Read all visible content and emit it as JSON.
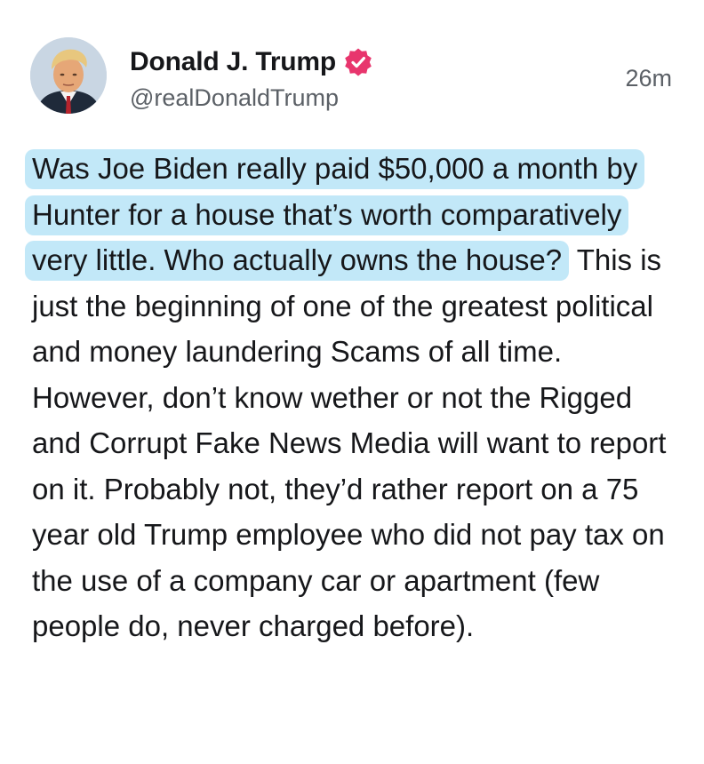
{
  "post": {
    "author": {
      "display_name": "Donald J. Trump",
      "handle": "@realDonaldTrump",
      "verified": true,
      "avatar_icon": "profile-photo",
      "verified_icon": "verified-badge-icon"
    },
    "timestamp": "26m",
    "highlighted_text": "Was Joe Biden really paid $50,000 a month by Hunter for a house that’s worth comparatively very little. Who actually owns the house?",
    "body_text": " This is just the beginning of one of the greatest political and money laundering Scams of all time. However, don’t know wether or not the Rigged and Corrupt Fake News Media will want to report on it. Probably not, they’d rather report on a 75 year old Trump employee who did not pay tax on the use of a company car or apartment (few people do, never charged before).",
    "colors": {
      "text": "#16171a",
      "secondary_text": "#5b6066",
      "highlight": "#78cdf0",
      "verified_badge": "#e8356d"
    }
  }
}
